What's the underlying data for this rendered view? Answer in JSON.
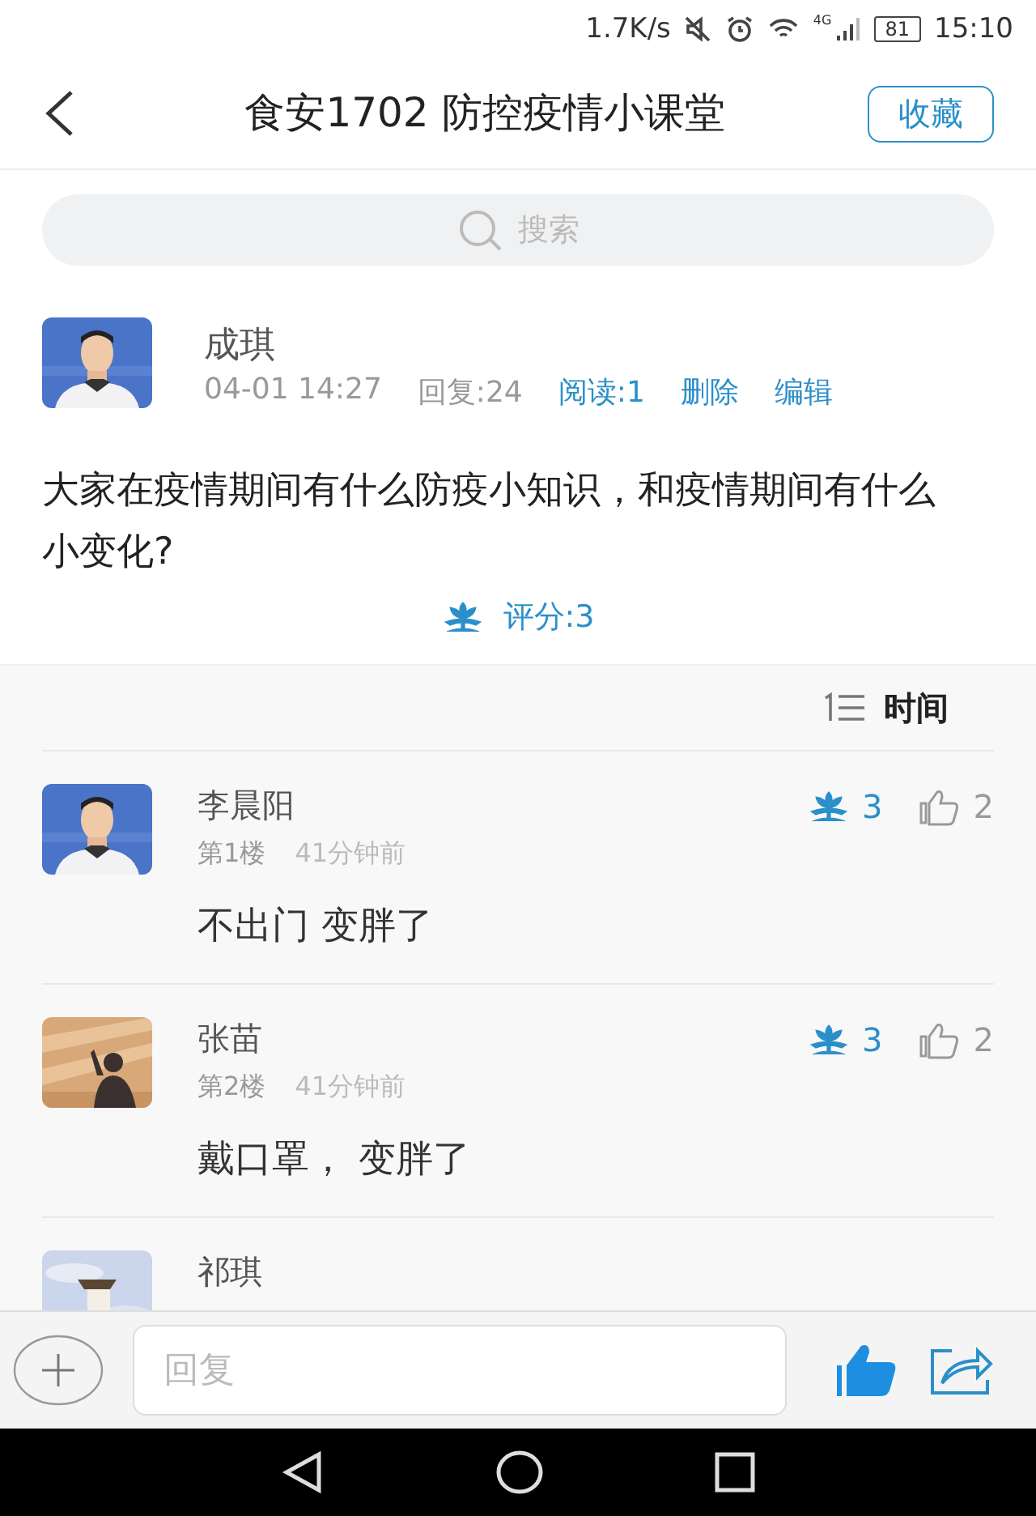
{
  "status_bar": {
    "speed": "1.7K/s",
    "network": "4G",
    "battery": "81",
    "time": "15:10"
  },
  "header": {
    "title": "食安1702 防控疫情小课堂",
    "favorite_button": "收藏"
  },
  "search": {
    "placeholder": "搜索"
  },
  "post": {
    "author": "成琪",
    "date": "04-01 14:27",
    "replies": "回复:24",
    "reads": "阅读:1",
    "actions": [
      "删除",
      "编辑"
    ],
    "body": "大家在疫情期间有什么防疫小知识，和疫情期间有什么小变化?",
    "rating": "评分:3"
  },
  "sort": {
    "label": "时间"
  },
  "comments": [
    {
      "kind": "full",
      "name": "李晨阳",
      "floor": "第1楼",
      "time": "41分钟前",
      "text": "不出门  变胖了",
      "flowers": "3",
      "likes": "2"
    },
    {
      "kind": "full",
      "name": "张苗",
      "floor": "第2楼",
      "time": "41分钟前",
      "text": "戴口罩，  变胖了",
      "flowers": "3",
      "likes": "2"
    },
    {
      "kind": "cut",
      "name": "祁琪"
    }
  ],
  "reply_bar": {
    "placeholder": "回复"
  }
}
